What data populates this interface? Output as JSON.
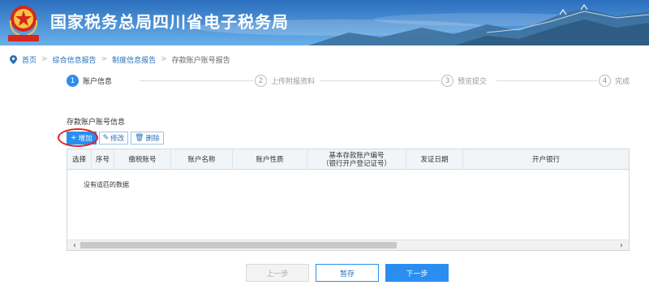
{
  "header": {
    "title": "国家税务总局四川省电子税务局",
    "emblem_text": "中国税务"
  },
  "breadcrumb": {
    "items": [
      "首页",
      "综合信息报告",
      "制度信息报告",
      "存款账户账号报告"
    ]
  },
  "steps": [
    {
      "num": "1",
      "label": "账户信息",
      "active": true
    },
    {
      "num": "2",
      "label": "上传附报资料",
      "active": false
    },
    {
      "num": "3",
      "label": "预览提交",
      "active": false
    },
    {
      "num": "4",
      "label": "完成",
      "active": false
    }
  ],
  "section": {
    "title": "存款账户账号信息"
  },
  "toolbar": {
    "add_label": "增加",
    "edit_label": "修改",
    "delete_label": "删除"
  },
  "table": {
    "columns": [
      "选择",
      "序号",
      "缴税账号",
      "账户名称",
      "账户性质",
      "基本存款账户编号\n（银行开户登记证号）",
      "发证日期",
      "开户银行"
    ],
    "empty_text": "没有适匹的数据"
  },
  "buttons": {
    "prev": "上一步",
    "save": "暂存",
    "next": "下一步"
  },
  "colors": {
    "primary": "#2a8ef0",
    "header_blue": "#2a74c4",
    "highlight_red": "#e02424"
  }
}
